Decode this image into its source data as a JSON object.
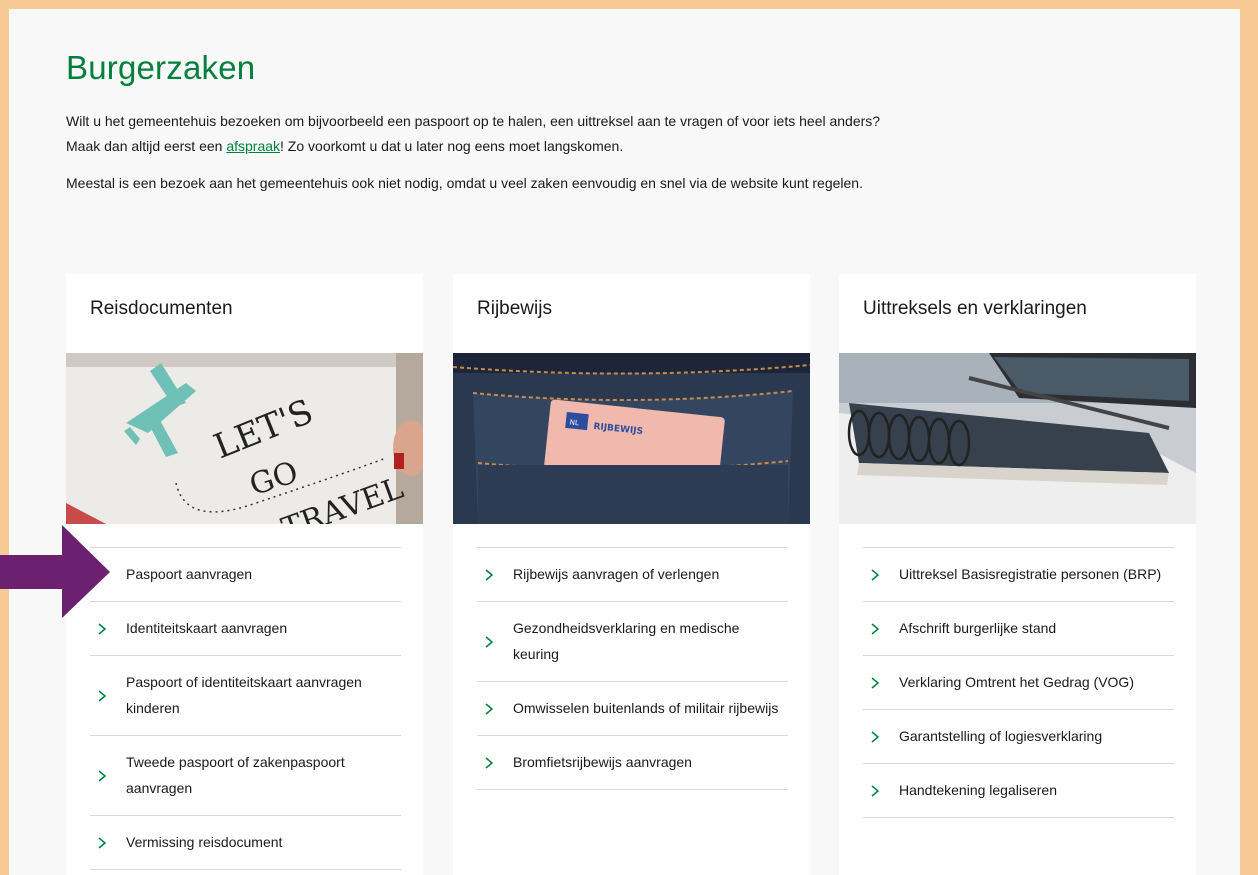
{
  "page": {
    "title": "Burgerzaken",
    "intro": {
      "p1_before": "Wilt u het gemeentehuis bezoeken om bijvoorbeeld een paspoort op te halen, een uittreksel aan te vragen of voor iets heel anders? Maak dan altijd eerst een ",
      "p1_link": "afspraak",
      "p1_after": "! Zo voorkomt u dat u later nog eens moet langskomen.",
      "p2": "Meestal is een bezoek aan het gemeentehuis ook niet nodig, omdat u veel zaken eenvoudig en snel via de website kunt regelen."
    }
  },
  "colors": {
    "accent": "#00803d",
    "frame": "#f7c995",
    "annotation_arrow": "#6b2070"
  },
  "cards": [
    {
      "title": "Reisdocumenten",
      "image_text": [
        "LET'S",
        "GO",
        "TRAVEL"
      ],
      "links": [
        "Paspoort aanvragen",
        "Identiteitskaart aanvragen",
        "Paspoort of identiteitskaart aanvragen kinderen",
        "Tweede paspoort of zakenpaspoort aanvragen",
        "Vermissing reisdocument"
      ]
    },
    {
      "title": "Rijbewijs",
      "image_text": [
        "RIJBEWIJS",
        "NL"
      ],
      "links": [
        "Rijbewijs aanvragen of verlengen",
        "Gezondheidsverklaring en medische keuring",
        "Omwisselen buitenlands of militair rijbewijs",
        "Bromfietsrijbewijs aanvragen"
      ]
    },
    {
      "title": "Uittreksels en verklaringen",
      "links": [
        "Uittreksel Basisregistratie personen (BRP)",
        "Afschrift burgerlijke stand",
        "Verklaring Omtrent het Gedrag (VOG)",
        "Garantstelling of logiesverklaring",
        "Handtekening legaliseren"
      ]
    }
  ],
  "icons": {
    "link_chevron": "chevron-right-icon",
    "annotation": "arrow-right-icon"
  }
}
